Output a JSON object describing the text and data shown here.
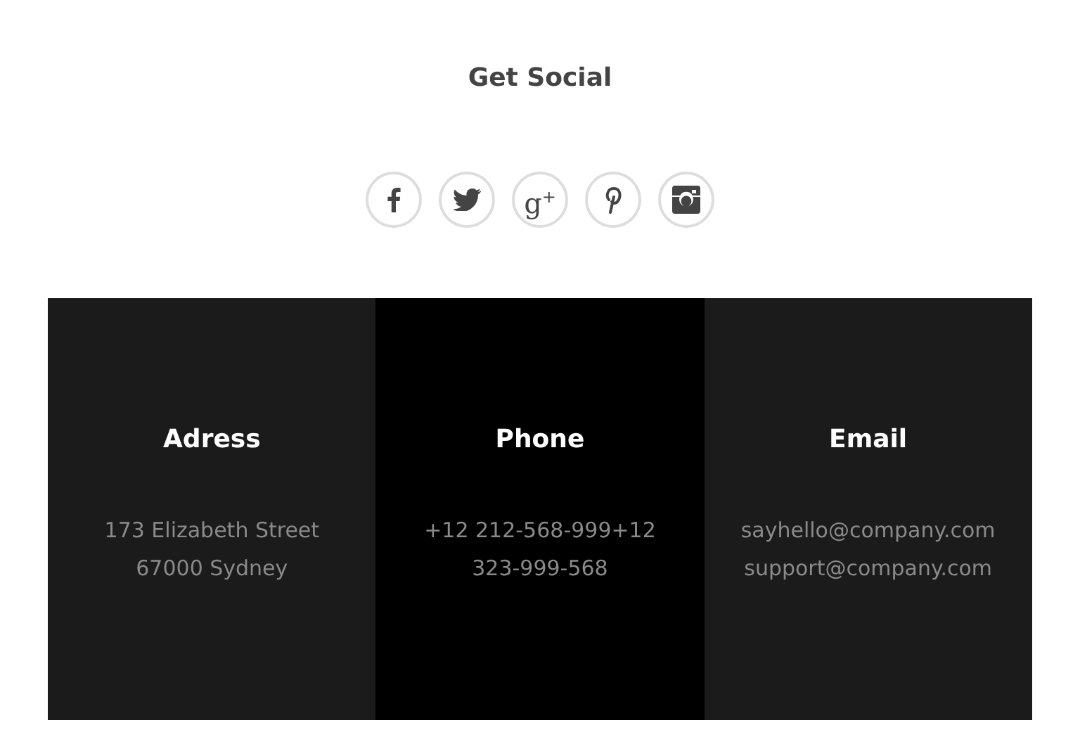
{
  "social": {
    "title": "Get Social",
    "icons": [
      {
        "kind": "facebook"
      },
      {
        "kind": "twitter"
      },
      {
        "kind": "googleplus",
        "glyph": "g$^{+}$"
      },
      {
        "kind": "pinterest"
      },
      {
        "kind": "instagram"
      }
    ]
  },
  "contact": [
    {
      "heading": "Adress",
      "lines": [
        "173 Elizabeth Street",
        "67000 Sydney"
      ]
    },
    {
      "heading": "Phone",
      "lines": [
        "+12 212-568-999+12",
        "323-999-568"
      ]
    },
    {
      "heading": "Email",
      "lines": [
        "sayhello@company.com",
        "support@company.com"
      ]
    }
  ]
}
